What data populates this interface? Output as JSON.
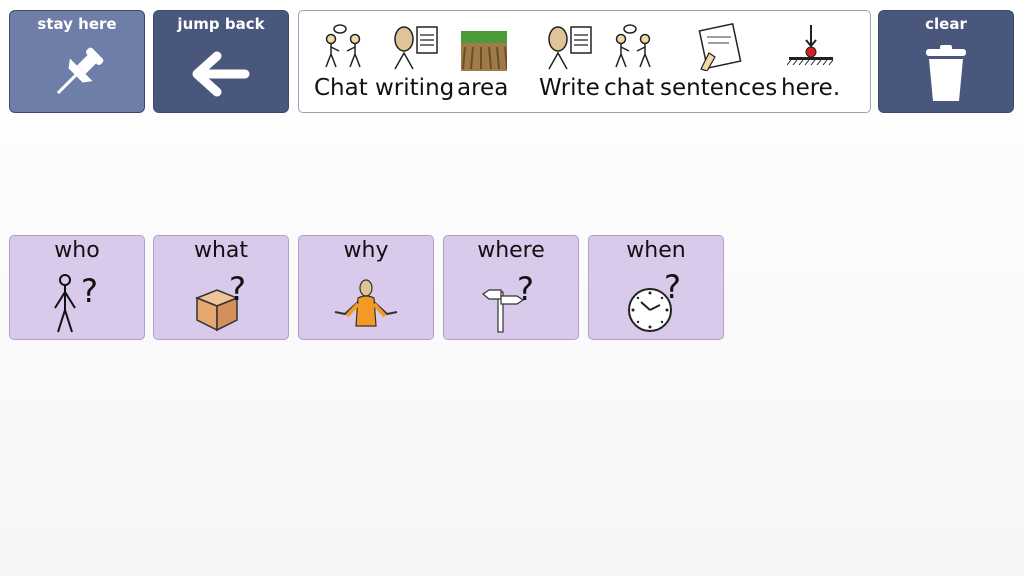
{
  "toolbar": {
    "stay_here": "stay here",
    "jump_back": "jump back",
    "clear": "clear"
  },
  "message_bar": {
    "words": [
      "Chat",
      "writing",
      "area",
      "Write",
      "chat",
      "sentences",
      "here."
    ]
  },
  "questions": [
    {
      "label": "who",
      "icon": "person-question-icon"
    },
    {
      "label": "what",
      "icon": "box-question-icon"
    },
    {
      "label": "why",
      "icon": "shrug-question-icon"
    },
    {
      "label": "where",
      "icon": "signpost-question-icon"
    },
    {
      "label": "when",
      "icon": "clock-question-icon"
    }
  ],
  "colors": {
    "toolbar_light": "#6e7ea9",
    "toolbar_dark": "#4a577c",
    "question_bg": "#d9c9ea",
    "question_border": "#b49ccf"
  }
}
